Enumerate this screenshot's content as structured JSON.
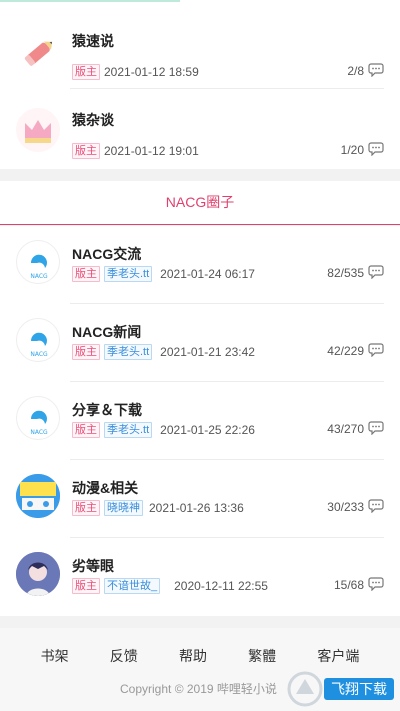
{
  "top_card": {
    "forums": [
      {
        "title": "猿速说",
        "tag": "版主",
        "time": "2021-01-12 18:59",
        "count": "2/8",
        "icon": "pencil-icon"
      },
      {
        "title": "猿杂谈",
        "tag": "版主",
        "time": "2021-01-12 19:01",
        "count": "1/20",
        "icon": "crown-icon"
      }
    ]
  },
  "section": {
    "title": "NACG圈子"
  },
  "nacg": {
    "forums": [
      {
        "title": "NACG交流",
        "tag": "版主",
        "user": "季老头.tt",
        "time": "2021-01-24 06:17",
        "count": "82/535",
        "icon": "nacg-logo-icon"
      },
      {
        "title": "NACG新闻",
        "tag": "版主",
        "user": "季老头.tt",
        "time": "2021-01-21 23:42",
        "count": "42/229",
        "icon": "nacg-logo-icon"
      },
      {
        "title": "分享＆下载",
        "tag": "版主",
        "user": "季老头.tt",
        "time": "2021-01-25 22:26",
        "count": "43/270",
        "icon": "nacg-logo-icon"
      },
      {
        "title": "动漫&相关",
        "tag": "版主",
        "user": "晓晓神",
        "time": "2021-01-26 13:36",
        "count": "30/233",
        "icon": "anime-badge-icon"
      },
      {
        "title": "劣等眼",
        "tag": "版主",
        "user": "不谙世故_",
        "time": "2020-12-11 22:55",
        "count": "15/68",
        "icon": "anime-girl-icon"
      }
    ]
  },
  "footer": {
    "nav": [
      "书架",
      "反馈",
      "帮助",
      "繁體",
      "客户端"
    ],
    "copyright": "Copyright © 2019 哔哩轻小说",
    "watermark": "飞翔下载"
  },
  "colors": {
    "accent": "#e0406e",
    "user_tag": "#3a8ed9",
    "background": "#f2f2f2"
  }
}
